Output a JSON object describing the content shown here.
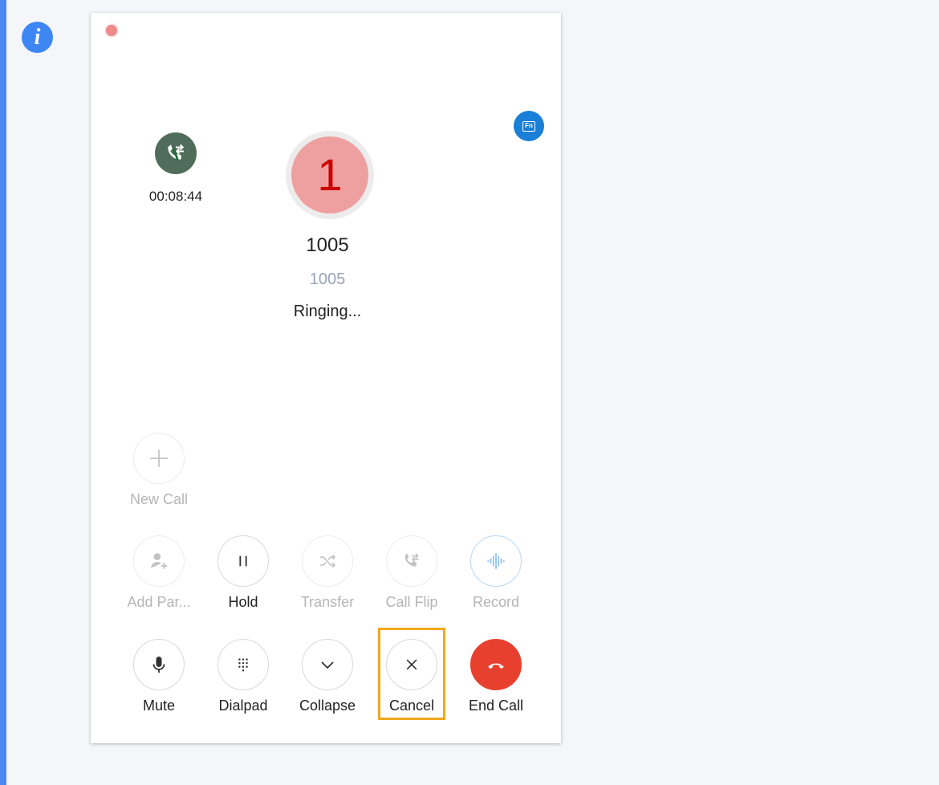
{
  "held_call": {
    "timer": "00:08:44"
  },
  "active_call": {
    "avatar_text": "1",
    "name": "1005",
    "number": "1005",
    "status": "Ringing..."
  },
  "controls": {
    "new_call": "New Call",
    "add_participant": "Add Par...",
    "hold": "Hold",
    "transfer": "Transfer",
    "call_flip": "Call Flip",
    "record": "Record",
    "mute": "Mute",
    "dialpad": "Dialpad",
    "collapse": "Collapse",
    "cancel": "Cancel",
    "end_call": "End Call"
  },
  "badge": {
    "fn": "Fn"
  },
  "colors": {
    "accent": "#3e86f3",
    "end_call": "#e8402f",
    "highlight": "#f0a91c",
    "avatar_bg": "#eea0a0",
    "avatar_text": "#cc0000"
  }
}
